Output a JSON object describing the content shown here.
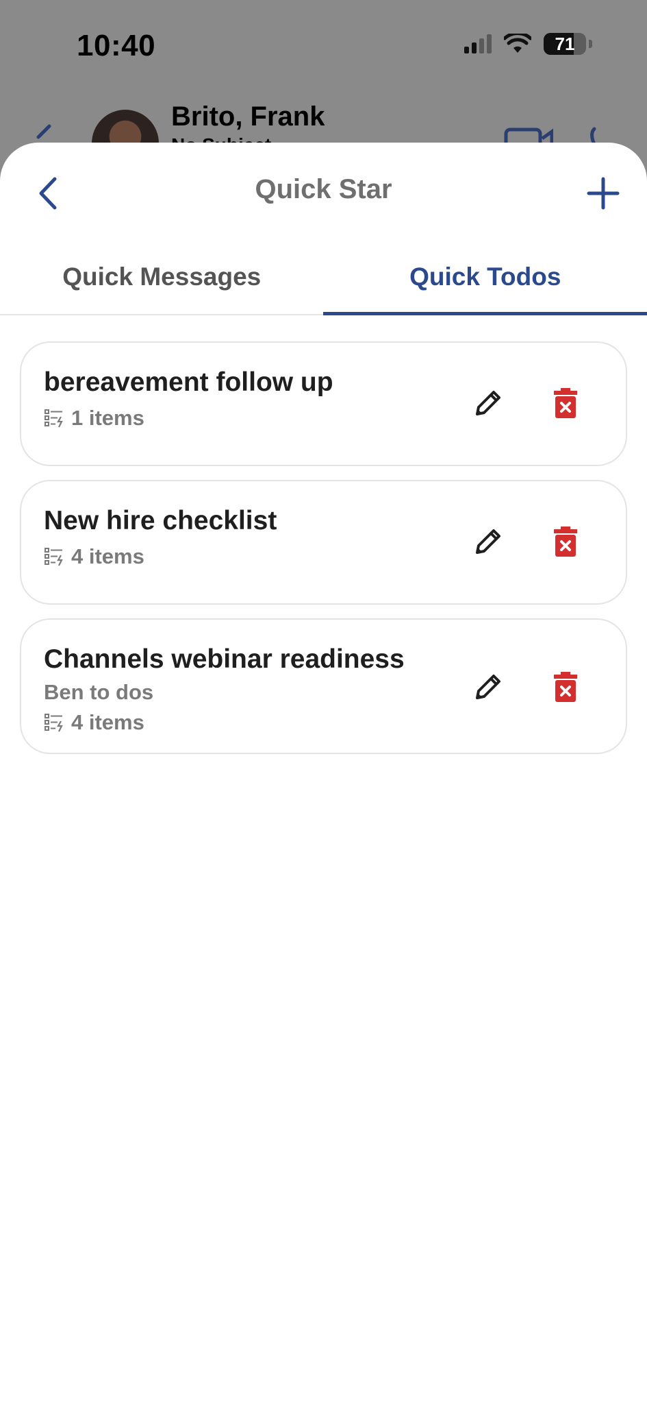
{
  "status_bar": {
    "time": "10:40",
    "battery": "71",
    "battery_level": 0.71
  },
  "background_chat": {
    "contact_name": "Brito, Frank",
    "subject": "No Subject"
  },
  "sheet": {
    "title": "Quick Star",
    "back_icon": "chevron-left-icon",
    "add_icon": "plus-icon"
  },
  "tabs": [
    {
      "label": "Quick Messages",
      "active": false
    },
    {
      "label": "Quick Todos",
      "active": true
    }
  ],
  "todos": [
    {
      "title": "bereavement follow up",
      "description": "",
      "count": "1 items"
    },
    {
      "title": "New hire checklist",
      "description": "",
      "count": "4 items"
    },
    {
      "title": "Channels webinar readiness",
      "description": "Ben to dos",
      "count": "4 items"
    }
  ],
  "colors": {
    "accent": "#2b4a8e",
    "delete": "#d32f2f",
    "overlay": "#8a8a8a"
  }
}
